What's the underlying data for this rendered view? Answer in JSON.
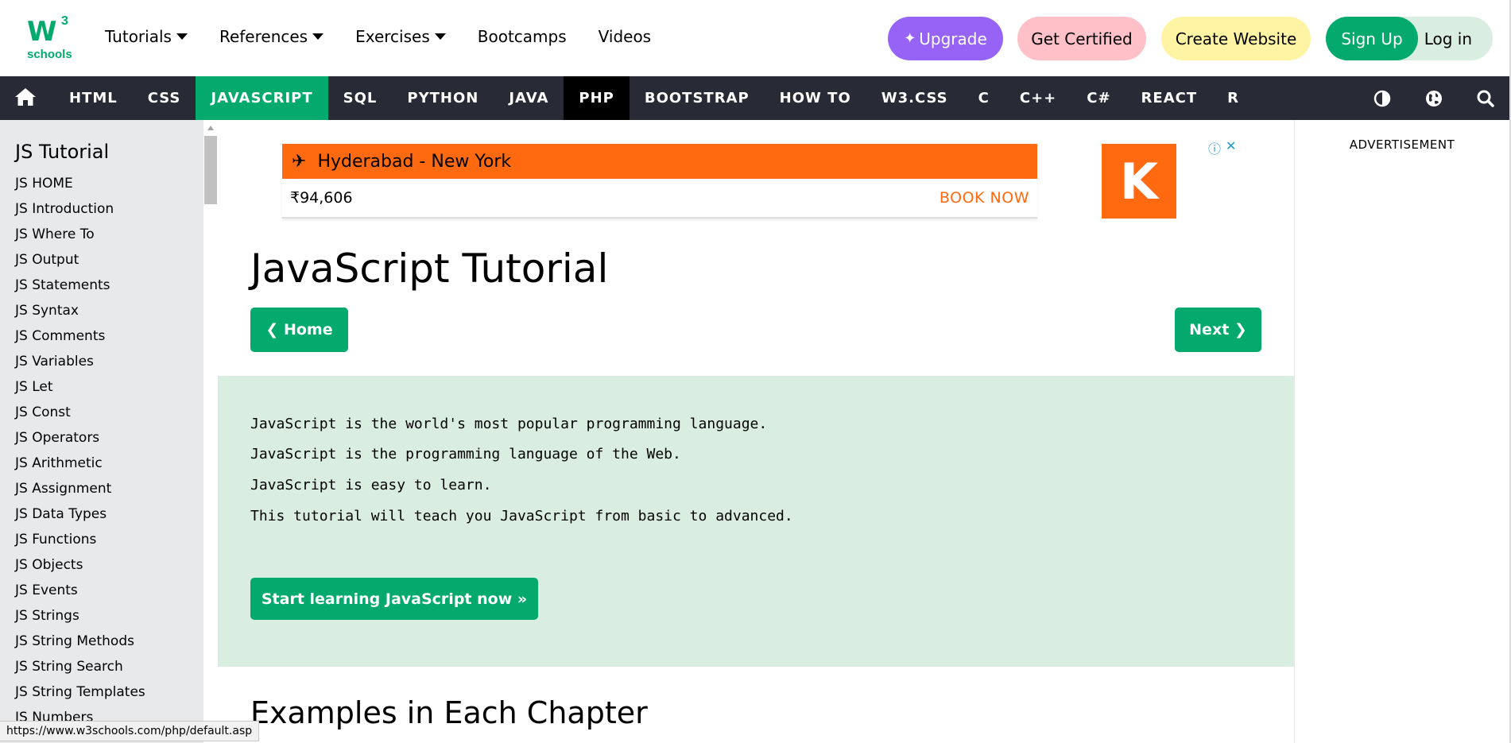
{
  "logo": {
    "mark": "W",
    "sup": "3",
    "word": "schools"
  },
  "topnav": [
    {
      "label": "Tutorials",
      "dropdown": true
    },
    {
      "label": "References",
      "dropdown": true
    },
    {
      "label": "Exercises",
      "dropdown": true
    },
    {
      "label": "Bootcamps",
      "dropdown": false
    },
    {
      "label": "Videos",
      "dropdown": false
    }
  ],
  "header_buttons": {
    "upgrade": "Upgrade",
    "certified": "Get Certified",
    "website": "Create Website",
    "signup": "Sign Up",
    "login": "Log in"
  },
  "subnav": {
    "links": [
      "HTML",
      "CSS",
      "JAVASCRIPT",
      "SQL",
      "PYTHON",
      "JAVA",
      "PHP",
      "BOOTSTRAP",
      "HOW TO",
      "W3.CSS",
      "C",
      "C++",
      "C#",
      "REACT",
      "R"
    ],
    "active": "JAVASCRIPT",
    "hovered": "PHP"
  },
  "sidebar": {
    "heading": "JS Tutorial",
    "items": [
      "JS HOME",
      "JS Introduction",
      "JS Where To",
      "JS Output",
      "JS Statements",
      "JS Syntax",
      "JS Comments",
      "JS Variables",
      "JS Let",
      "JS Const",
      "JS Operators",
      "JS Arithmetic",
      "JS Assignment",
      "JS Data Types",
      "JS Functions",
      "JS Objects",
      "JS Events",
      "JS Strings",
      "JS String Methods",
      "JS String Search",
      "JS String Templates",
      "JS Numbers"
    ]
  },
  "ad": {
    "route": "Hyderabad - New York",
    "price": "₹94,606",
    "cta": "BOOK NOW",
    "brand_letter": "K"
  },
  "main": {
    "title": "JavaScript Tutorial",
    "home_button": "Home",
    "next_button": "Next",
    "intro": [
      "JavaScript is the world's most popular programming language.",
      "JavaScript is the programming language of the Web.",
      "JavaScript is easy to learn.",
      "This tutorial will teach you JavaScript from basic to advanced."
    ],
    "start_button": "Start learning JavaScript now »",
    "section_heading": "Examples in Each Chapter"
  },
  "right_column": {
    "advertisement_label": "ADVERTISEMENT"
  },
  "status_url": "https://www.w3schools.com/php/default.asp",
  "colors": {
    "brand_green": "#04AA6D",
    "nav_dark": "#282A35",
    "upgrade_purple": "#9763f6",
    "certified_pink": "#ffc0c7",
    "website_yellow": "#fff4a3",
    "intro_bg": "#D9EEE1",
    "sidebar_bg": "#E7E9EB",
    "ad_orange": "#ff690f"
  }
}
